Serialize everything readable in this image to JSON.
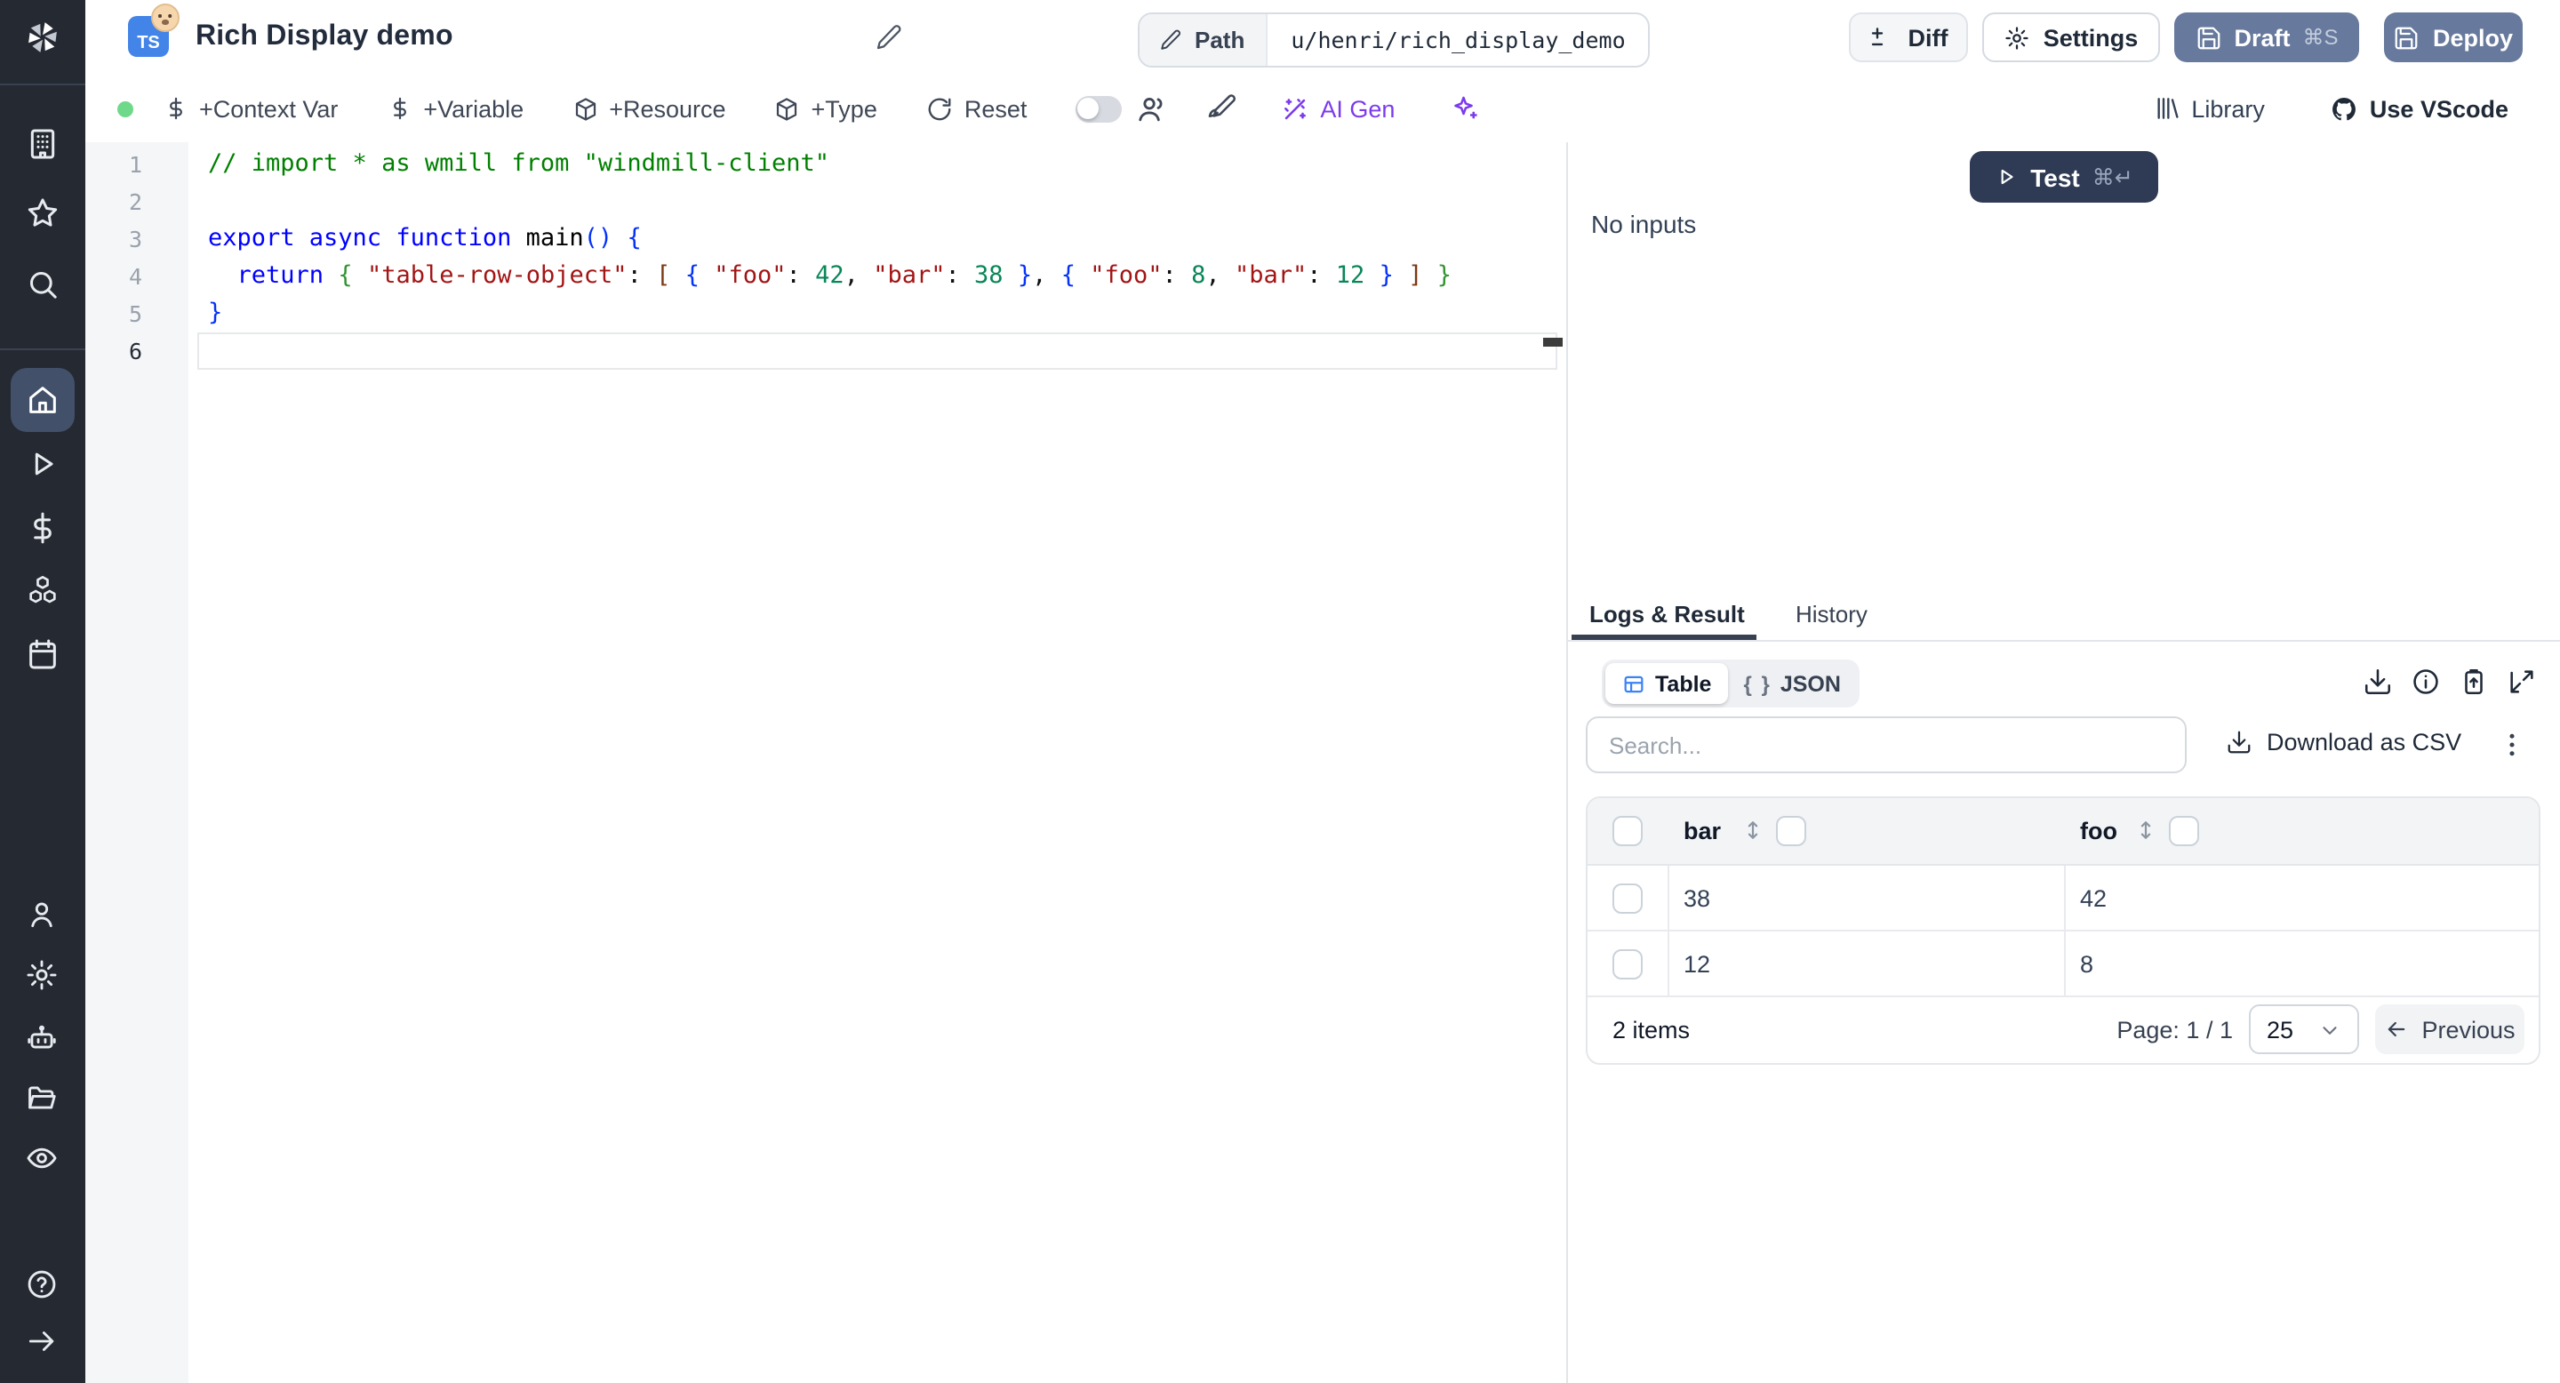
{
  "header": {
    "badge": "TS",
    "title": "Rich Display demo",
    "path_label": "Path",
    "path_value": "u/henri/rich_display_demo",
    "diff": "Diff",
    "settings": "Settings",
    "draft": "Draft",
    "draft_kbd": "⌘S",
    "deploy": "Deploy"
  },
  "toolbar": {
    "context_var": "+Context Var",
    "variable": "+Variable",
    "resource": "+Resource",
    "type": "+Type",
    "reset": "Reset",
    "ai_gen": "AI Gen",
    "library": "Library",
    "use_vscode": "Use VScode"
  },
  "editor": {
    "active_line": 6,
    "lines": [
      [
        [
          "// import * as wmill from \"windmill-client\"",
          "comment"
        ]
      ],
      [],
      [
        [
          "export async function ",
          "kw"
        ],
        [
          "main",
          "ident"
        ],
        [
          "()",
          "b1"
        ],
        [
          " ",
          ""
        ],
        [
          "{",
          "b1"
        ]
      ],
      [
        [
          "  ",
          ""
        ],
        [
          "return",
          "kw"
        ],
        [
          " ",
          ""
        ],
        [
          "{",
          "b2"
        ],
        [
          " ",
          ""
        ],
        [
          "\"table-row-object\"",
          "str"
        ],
        [
          ":",
          "pun"
        ],
        [
          " ",
          ""
        ],
        [
          "[",
          "b3"
        ],
        [
          " ",
          ""
        ],
        [
          "{",
          "b1"
        ],
        [
          " ",
          ""
        ],
        [
          "\"foo\"",
          "str"
        ],
        [
          ":",
          "pun"
        ],
        [
          " ",
          ""
        ],
        [
          "42",
          "num"
        ],
        [
          ",",
          "pun"
        ],
        [
          " ",
          ""
        ],
        [
          "\"bar\"",
          "str"
        ],
        [
          ":",
          "pun"
        ],
        [
          " ",
          ""
        ],
        [
          "38",
          "num"
        ],
        [
          " ",
          ""
        ],
        [
          "}",
          "b1"
        ],
        [
          ",",
          "pun"
        ],
        [
          " ",
          ""
        ],
        [
          "{",
          "b1"
        ],
        [
          " ",
          ""
        ],
        [
          "\"foo\"",
          "str"
        ],
        [
          ":",
          "pun"
        ],
        [
          " ",
          ""
        ],
        [
          "8",
          "num"
        ],
        [
          ",",
          "pun"
        ],
        [
          " ",
          ""
        ],
        [
          "\"bar\"",
          "str"
        ],
        [
          ":",
          "pun"
        ],
        [
          " ",
          ""
        ],
        [
          "12",
          "num"
        ],
        [
          " ",
          ""
        ],
        [
          "}",
          "b1"
        ],
        [
          " ",
          ""
        ],
        [
          "]",
          "b3"
        ],
        [
          " ",
          ""
        ],
        [
          "}",
          "b2"
        ]
      ],
      [
        [
          "}",
          "b1"
        ]
      ],
      []
    ]
  },
  "run_panel": {
    "test": "Test",
    "test_kbd": "⌘↵",
    "no_inputs": "No inputs",
    "tabs": [
      {
        "label": "Logs & Result",
        "active": true
      },
      {
        "label": "History",
        "active": false
      }
    ],
    "view_modes": [
      {
        "label": "Table",
        "active": true
      },
      {
        "label": "JSON",
        "active": false
      }
    ],
    "json_icon": "{ }"
  },
  "result_table": {
    "search_placeholder": "Search...",
    "download_csv": "Download as CSV",
    "columns": [
      "bar",
      "foo"
    ],
    "rows": [
      [
        "38",
        "42"
      ],
      [
        "12",
        "8"
      ]
    ],
    "items_count": "2 items",
    "page_label": "Page: 1 / 1",
    "page_size": "25",
    "previous": "Previous"
  },
  "colors": {
    "sidebar_bg": "#252932",
    "active_nav_bg": "#42506a",
    "slate_button": "#67799c",
    "test_button": "#2f3b54",
    "accent_violet": "#7c3aed",
    "status_green": "#6fd98a",
    "table_icon_blue": "#3b82f6",
    "ts_badge_blue": "#4384e8"
  }
}
